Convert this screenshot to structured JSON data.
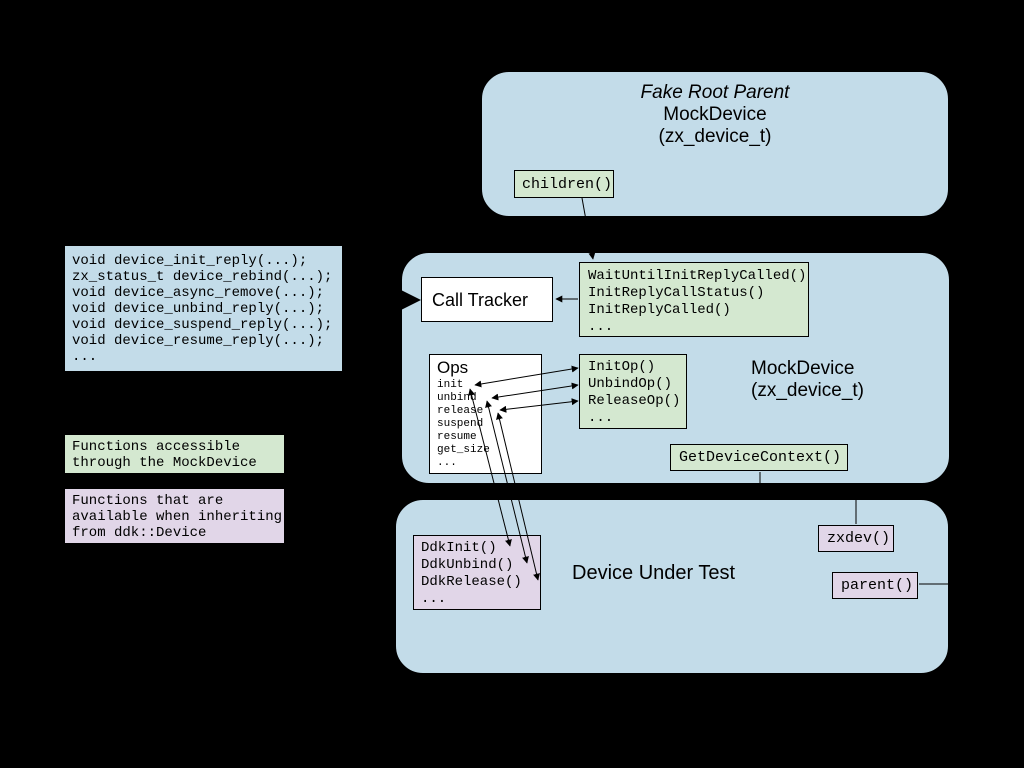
{
  "fake_root": {
    "title_italic": "Fake Root Parent",
    "title2": "MockDevice",
    "title3": "(zx_device_t)",
    "children_fn": "children()"
  },
  "api_list": {
    "lines": [
      "void device_init_reply(...);",
      "zx_status_t device_rebind(...);",
      "void device_async_remove(...);",
      "void device_unbind_reply(...);",
      "void device_suspend_reply(...);",
      "void device_resume_reply(...);",
      "..."
    ]
  },
  "legend": {
    "green": "Functions accessible\nthrough the MockDevice",
    "purple": "Functions that are\navailable when inheriting\nfrom ddk::Device"
  },
  "calltracker": {
    "label": "Call Tracker"
  },
  "tracker_fns": {
    "lines": [
      "WaitUntilInitReplyCalled()",
      "InitReplyCallStatus()",
      "InitReplyCalled()",
      "..."
    ]
  },
  "ops": {
    "title": "Ops",
    "items": [
      "init",
      "unbind",
      "release",
      "suspend",
      "resume",
      "get_size",
      "..."
    ]
  },
  "ops_fns": {
    "lines": [
      "InitOp()",
      "UnbindOp()",
      "ReleaseOp()",
      "..."
    ]
  },
  "mockdevice2": {
    "title": "MockDevice",
    "sub": "(zx_device_t)"
  },
  "get_ctx": {
    "label": "GetDeviceContext()"
  },
  "dut": {
    "title": "Device Under Test",
    "ddk_fns": {
      "lines": [
        "DdkInit()",
        "DdkUnbind()",
        "DdkRelease()",
        "..."
      ]
    },
    "zxdev": "zxdev()",
    "parent": "parent()"
  }
}
